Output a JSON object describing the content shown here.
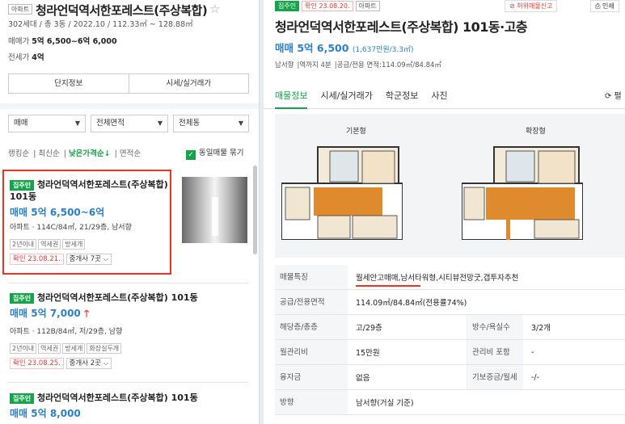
{
  "left": {
    "type_tag": "아파트",
    "title": "청라언덕역서한포레스트(주상복합)",
    "summary": "302세대 / 총 3동 / 2022.10 / 112.33㎡ ~ 128.88㎡",
    "sale_label": "매매가",
    "sale_value": "5억 6,500~6억 6,000",
    "jeonse_label": "전세가",
    "jeonse_value": "4억",
    "btn_complex": "단지정보",
    "btn_price": "시세/실거래가",
    "filter_trade": "매매",
    "filter_area": "전체면적",
    "filter_dong": "전체동",
    "sort": [
      "랭킹순",
      "최신순",
      "낮은가격순↓",
      "면적순"
    ],
    "same_listing": "동일매물 묶기",
    "items": [
      {
        "badge": "집주인",
        "title": "청라언덕역서한포레스트(주상복합) 101동",
        "price": "매매 5억 6,500~6억",
        "desc": "아파트 · 114C/84㎡, 21/29층, 남서향",
        "chips": [
          "2년이내",
          "역세권",
          "방세개"
        ],
        "confirm": "확인 23.08.21.",
        "agents": "중개사 7곳 ⌵"
      },
      {
        "badge": "집주인",
        "title": "청라언덕역서한포레스트(주상복합) 101동",
        "price": "매매 5억 7,000",
        "arrow": "🡑",
        "desc": "아파트 · 112B/84㎡, 저/29층, 남향",
        "chips": [
          "2년이내",
          "역세권",
          "방세개",
          "화장실두개"
        ],
        "confirm": "확인 23.08.25.",
        "agents": "중개사 2곳 ⌵"
      },
      {
        "badge": "집주인",
        "title": "청라언덕역서한포레스트(주상복합) 101동",
        "price": "매매 5억 8,000"
      }
    ]
  },
  "right": {
    "tags": [
      "집주인",
      "확인 23.08.20.",
      "아파트"
    ],
    "report": "허위매물신고",
    "print": "인쇄",
    "title": "청라언덕역서한포레스트(주상복합) 101동·고층",
    "price": "매매 5억 6,500",
    "price_unit": "(1,637만원/3.3㎡)",
    "info": [
      "남서향",
      "역까지 4분",
      "공급/전용 면적:114.09㎡/84.84㎡"
    ],
    "tabs": [
      "매물정보",
      "시세/실거래가",
      "학군정보",
      "사진"
    ],
    "refresh": "⟳ 펼",
    "plan_basic": "기본형",
    "plan_ext": "확장형",
    "rows": [
      {
        "k": "매물특징",
        "v": "월세안고매매,남서타워형,시티뷰전망굿,갭투자추천"
      },
      {
        "k": "공급/전용면적",
        "v": "114.09㎡/84.84㎡(전용률74%)"
      },
      {
        "k": "해당층/총층",
        "v": "고/29층",
        "k2": "방수/욕실수",
        "v2": "3/2개"
      },
      {
        "k": "월관리비",
        "v": "15만원",
        "k2": "관리비 포함",
        "v2": "-"
      },
      {
        "k": "융자금",
        "v": "없음",
        "k2": "기보증금/월세",
        "v2": "-/-"
      },
      {
        "k": "방향",
        "v": "남서향(거실 기준)"
      }
    ]
  },
  "colors": {
    "accent_green": "#16a34a",
    "price_blue": "#2a7fcc",
    "highlight_red": "#e32"
  }
}
